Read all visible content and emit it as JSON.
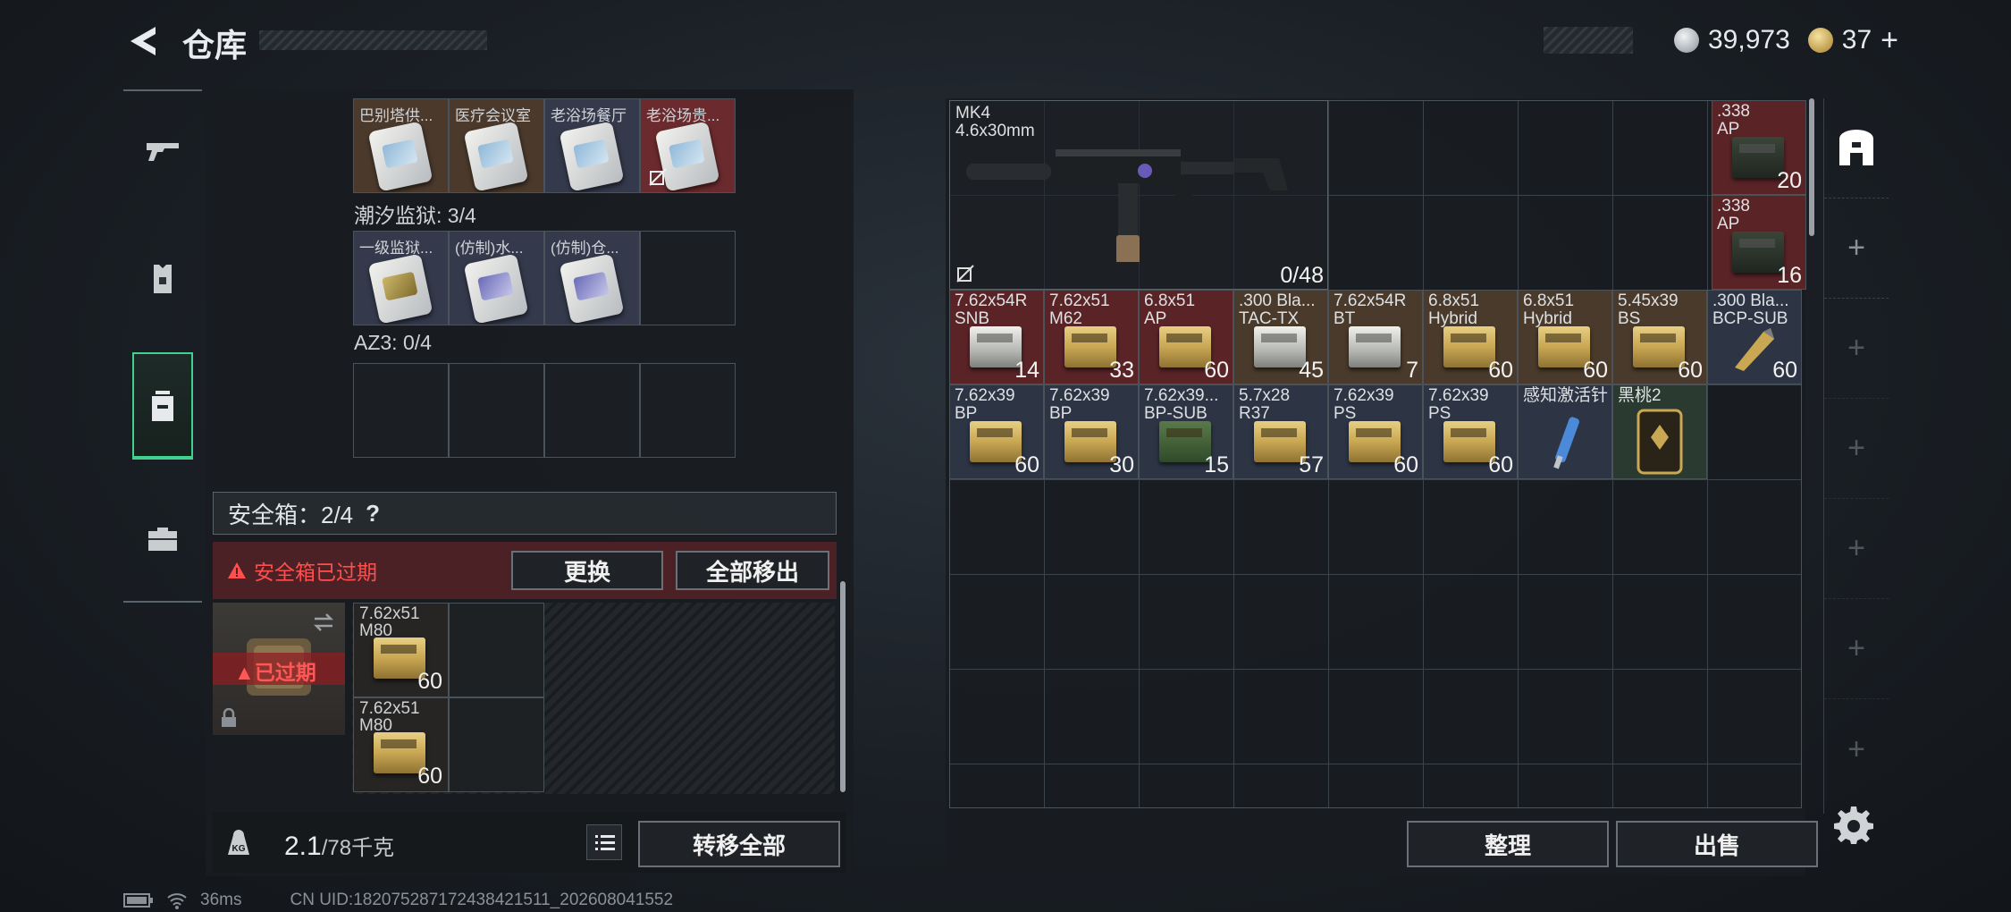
{
  "header": {
    "title": "仓库",
    "silver_amount": "39,973",
    "gold_amount": "37",
    "gold_plus": "+"
  },
  "categories": [
    {
      "name": "weapons",
      "icon": "gun-icon"
    },
    {
      "name": "armor",
      "icon": "armor-icon"
    },
    {
      "name": "backpack",
      "icon": "backpack-icon"
    },
    {
      "name": "equipment",
      "icon": "briefcase-icon"
    }
  ],
  "left": {
    "keycards_top": [
      {
        "label": "巴别塔供...",
        "style": "brown",
        "card": "plain",
        "broken": false
      },
      {
        "label": "医疗会议室",
        "style": "brown",
        "card": "plain",
        "broken": false
      },
      {
        "label": "老浴场餐厅",
        "style": "blue",
        "card": "plain",
        "broken": false
      },
      {
        "label": "老浴场贵...",
        "style": "red",
        "card": "plain",
        "broken": true
      }
    ],
    "prison_label": "潮汐监狱: 3/4",
    "prison_cards": [
      {
        "label": "一级监狱...",
        "style": "blue",
        "card": "gold"
      },
      {
        "label": "(仿制)水...",
        "style": "blue",
        "card": "purple"
      },
      {
        "label": "(仿制)仓...",
        "style": "blue",
        "card": "purple"
      }
    ],
    "az3_label": "AZ3: 0/4",
    "safebox_label": "安全箱：2/4",
    "help": "?",
    "expired_warning": "安全箱已过期",
    "replace_button": "更换",
    "remove_all_button": "全部移出",
    "expired_tag": "已过期",
    "safe_items": [
      {
        "label": "7.62x51\nM80",
        "count": "60"
      },
      {
        "label": "7.62x51\nM80",
        "count": "60"
      }
    ],
    "weight_value": "2.1",
    "weight_max": "/78千克",
    "transfer_all_button": "转移全部"
  },
  "right": {
    "weapon_name": "MK4",
    "weapon_caliber": "4.6x30mm",
    "weapon_ammo": "0/48",
    "side_ammo": [
      {
        "label": ".338\nAP",
        "count": "20"
      },
      {
        "label": ".338\nAP",
        "count": "16"
      }
    ],
    "row3": [
      {
        "label": "7.62x54R\nSNB",
        "count": "14",
        "bg": "red",
        "box": "silver"
      },
      {
        "label": "7.62x51\nM62",
        "count": "33",
        "bg": "red",
        "box": "gold"
      },
      {
        "label": "6.8x51\nAP",
        "count": "60",
        "bg": "red",
        "box": "gold"
      },
      {
        "label": ".300 Bla...\nTAC-TX",
        "count": "45",
        "bg": "brown",
        "box": "silver"
      },
      {
        "label": "7.62x54R\nBT",
        "count": "7",
        "bg": "brown",
        "box": "silver"
      },
      {
        "label": "6.8x51\nHybrid",
        "count": "60",
        "bg": "brown",
        "box": "gold"
      },
      {
        "label": "6.8x51\nHybrid",
        "count": "60",
        "bg": "brown",
        "box": "gold"
      },
      {
        "label": "5.45x39\nBS",
        "count": "60",
        "bg": "brown",
        "box": "gold"
      },
      {
        "label": ".300 Bla...\nBCP-SUB",
        "count": "60",
        "bg": "blue",
        "box": "bullet"
      }
    ],
    "row4": [
      {
        "label": "7.62x39\nBP",
        "count": "60",
        "bg": "blue",
        "box": "gold"
      },
      {
        "label": "7.62x39\nBP",
        "count": "30",
        "bg": "blue",
        "box": "gold"
      },
      {
        "label": "7.62x39...\nBP-SUB",
        "count": "15",
        "bg": "blue",
        "box": "green"
      },
      {
        "label": "5.7x28\nR37",
        "count": "57",
        "bg": "blue",
        "box": "gold"
      },
      {
        "label": "7.62x39\nPS",
        "count": "60",
        "bg": "blue",
        "box": "gold"
      },
      {
        "label": "7.62x39\nPS",
        "count": "60",
        "bg": "blue",
        "box": "gold"
      },
      {
        "label": "感知激活针",
        "count": "",
        "bg": "blue",
        "box": "injector"
      },
      {
        "label": "黑桃2",
        "count": "",
        "bg": "green",
        "box": "card"
      }
    ],
    "sort_button": "整理",
    "sell_button": "出售",
    "side_plus": "+"
  },
  "status": {
    "ping": "36ms",
    "uid": "CN UID:18207528717243842151​1_202608041552"
  },
  "colors": {
    "accent_green": "#3fd18d",
    "warning_red": "#ff4e4e"
  }
}
